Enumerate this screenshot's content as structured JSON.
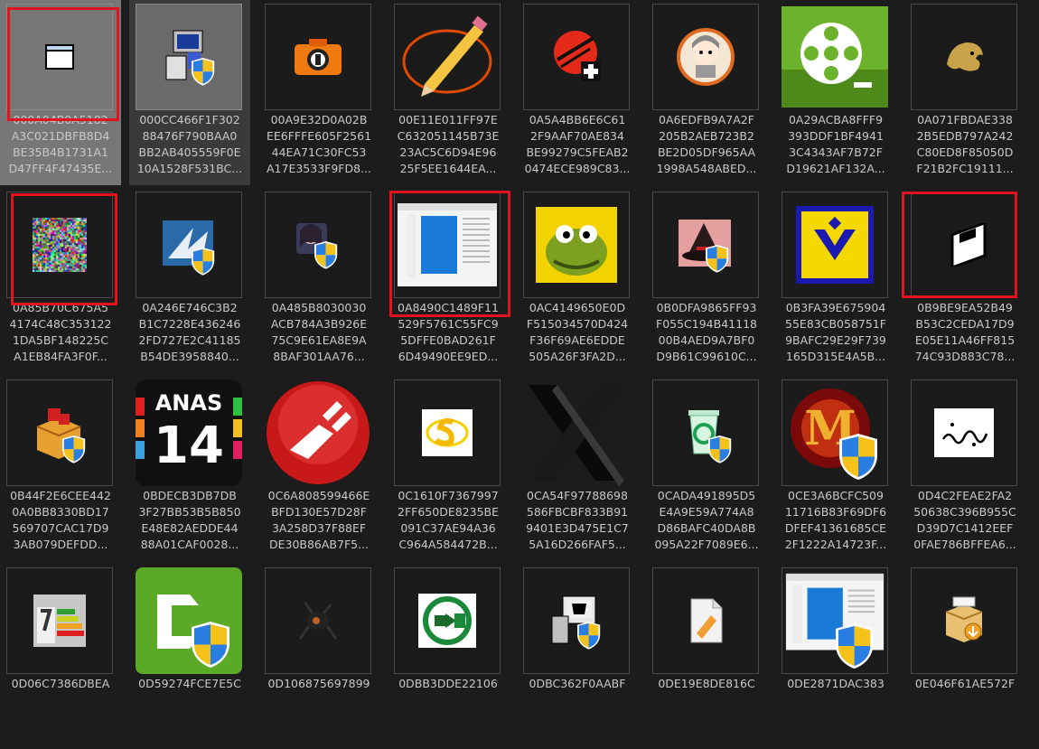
{
  "files": [
    {
      "lines": [
        "000A04B0A5182",
        "A3C021DBFB8D4",
        "BE35B4B1731A1",
        "D47FF4F47435E..."
      ],
      "icon": "window-icon",
      "selected": true
    },
    {
      "lines": [
        "000CC466F1F302",
        "88476F790BAA0",
        "BB2AB405559F0E",
        "10A1528F531BC..."
      ],
      "icon": "computer-setup-shield-icon",
      "selected": true
    },
    {
      "lines": [
        "00A9E32D0A02B",
        "EE6FFFE605F2561",
        "44EA71C30FC53",
        "A17E3533F9FD8..."
      ],
      "icon": "orange-camera-icon"
    },
    {
      "lines": [
        "00E11E011FF97E",
        "C632051145B73E",
        "23AC5C6D94E96",
        "25F5EE1644EA..."
      ],
      "icon": "pencil-swirl-icon"
    },
    {
      "lines": [
        "0A5A4BB6E6C61",
        "2F9AAF70AE834",
        "BE99279C5FEAB2",
        "0474ECE989C83..."
      ],
      "icon": "red-disc-plus-icon"
    },
    {
      "lines": [
        "0A6EDFB9A7A2F",
        "205B2AEB723B2",
        "BE2D05DF965AA",
        "1998A548ABED..."
      ],
      "icon": "anime-avatar-icon"
    },
    {
      "lines": [
        "0A29ACBA8FFF9",
        "393DDF1BF4941",
        "3C4343AF7B72F",
        "D19621AF132A..."
      ],
      "icon": "film-reel-icon"
    },
    {
      "lines": [
        "0A071FBDAE338",
        "2B5EDB797A242",
        "C80ED8F85050D",
        "F21B2FC19111..."
      ],
      "icon": "lion-logo-icon"
    },
    {
      "lines": [
        "0A85B70C675A5",
        "4174C48C353122",
        "1DA5BF148225C",
        "A1EB84FA3F0F..."
      ],
      "icon": "noise-pattern-icon"
    },
    {
      "lines": [
        "0A246E746C3B2",
        "B1C7228E436246",
        "2FD727E2C41185",
        "B54DE3958840..."
      ],
      "icon": "blue-app-shield-icon"
    },
    {
      "lines": [
        "0A485B8030030",
        "ACB784A3B926E",
        "75C9E61EA8E9A",
        "8BAF301AA76..."
      ],
      "icon": "character-portrait-shield-icon"
    },
    {
      "lines": [
        "0A8490C1489F11",
        "529F5761C55FC9",
        "5DFFE0BAD261F",
        "6D49490EE9ED..."
      ],
      "icon": "window-preview-icon"
    },
    {
      "lines": [
        "0AC4149650E0D",
        "F515034570D424",
        "F36F69AE6EDDE",
        "505A26F3FA2D..."
      ],
      "icon": "green-creature-icon"
    },
    {
      "lines": [
        "0B0DFA9865FF93",
        "F055C194B41118",
        "00B4AED9A7BF0",
        "D9B61C99610C..."
      ],
      "icon": "witch-hat-shield-icon"
    },
    {
      "lines": [
        "0B3FA39E675904",
        "55E83CB058751F",
        "9BAFC29E29F739",
        "165D315E4A5B..."
      ],
      "icon": "yellow-v-logo-icon"
    },
    {
      "lines": [
        "0B9BE9EA52B49",
        "B53C2CEDA17D9",
        "E05E11A46FF815",
        "74C93D883C78..."
      ],
      "icon": "floppy-disk-icon"
    },
    {
      "lines": [
        "0B44F2E6CEE442",
        "0A0BB8330BD17",
        "569707CAC17D9",
        "3AB079DEFDD..."
      ],
      "icon": "installer-box-shield-icon"
    },
    {
      "lines": [
        "0BDECB3DB7DB",
        "3F27BB53B5B850",
        "E48E82AEDDE44",
        "88A01CAF0028..."
      ],
      "icon": "anas-14-icon"
    },
    {
      "lines": [
        "0C6A808599466E",
        "BFD130E57D28F",
        "3A258D37F88EF",
        "DE30B86AB7F5..."
      ],
      "icon": "red-plug-icon"
    },
    {
      "lines": [
        "0C1610F7367997",
        "2FF650DE8235BE",
        "091C37AE94A36",
        "C964A584472B..."
      ],
      "icon": "yellow-s-logo-icon"
    },
    {
      "lines": [
        "0CA54F97788698",
        "586FBCBF833B91",
        "9401E3D475E1C7",
        "5A16D266FAF5..."
      ],
      "icon": "black-x-icon"
    },
    {
      "lines": [
        "0CADA491895D5",
        "E4A9E59A774A8",
        "D86BAFC40DA8B",
        "095A22F7089E6..."
      ],
      "icon": "recycle-bin-shield-icon"
    },
    {
      "lines": [
        "0CE3A6BCFC509",
        "11716B83F69DF6",
        "DFEF41361685CE",
        "2F1222A14723F..."
      ],
      "icon": "m-logo-shield-icon"
    },
    {
      "lines": [
        "0D4C2FEAE2FA2",
        "50638C396B955C",
        "D39D7C1412EEF",
        "0FAE786BFFEA6..."
      ],
      "icon": "persian-text-icon"
    },
    {
      "lines": [
        "0D06C7386DBEA"
      ],
      "icon": "energy-label-icon"
    },
    {
      "lines": [
        "0D59274FCE7E5C"
      ],
      "icon": "camtasia-shield-icon"
    },
    {
      "lines": [
        "0D106875697899"
      ],
      "icon": "dark-creature-icon"
    },
    {
      "lines": [
        "0DBB3DDE22106"
      ],
      "icon": "green-sync-icon"
    },
    {
      "lines": [
        "0DBC362F0AABF"
      ],
      "icon": "setup-program-shield-icon"
    },
    {
      "lines": [
        "0DE19E8DE816C"
      ],
      "icon": "document-pen-icon"
    },
    {
      "lines": [
        "0DE2871DAC383"
      ],
      "icon": "window-preview-shield-icon"
    },
    {
      "lines": [
        "0E046F61AE572F"
      ],
      "icon": "installer-box-arrow-icon"
    }
  ]
}
